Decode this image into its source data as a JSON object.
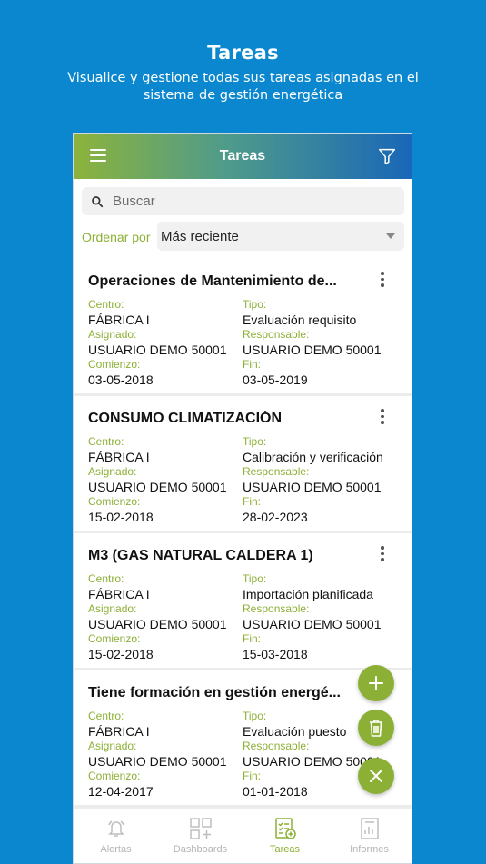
{
  "promo": {
    "title": "Tareas",
    "subtitle": "Visualice y gestione todas sus tareas asignadas en el sistema de gestión energética"
  },
  "appbar": {
    "title": "Tareas",
    "menu_icon": "hamburger-menu-icon",
    "filter_icon": "filter-funnel-icon"
  },
  "search": {
    "placeholder": "Buscar",
    "value": ""
  },
  "sort": {
    "label": "Ordenar por",
    "value": "Más reciente"
  },
  "field_labels": {
    "centro": "Centro:",
    "tipo": "Tipo:",
    "asignado": "Asignado:",
    "responsable": "Responsable:",
    "comienzo": "Comienzo:",
    "fin": "Fin:"
  },
  "tasks": [
    {
      "title": "Operaciones de Mantenimiento de...",
      "centro": "FÁBRICA I",
      "tipo": "Evaluación requisito",
      "asignado": "USUARIO DEMO 50001",
      "responsable": "USUARIO DEMO 50001",
      "comienzo": "03-05-2018",
      "fin": "03-05-2019"
    },
    {
      "title": "CONSUMO CLIMATIZACIÓN",
      "centro": "FÁBRICA I",
      "tipo": "Calibración y verificación",
      "asignado": "USUARIO DEMO 50001",
      "responsable": "USUARIO DEMO 50001",
      "comienzo": "15-02-2018",
      "fin": "28-02-2023"
    },
    {
      "title": "M3 (GAS NATURAL CALDERA 1)",
      "centro": "FÁBRICA I",
      "tipo": "Importación planificada",
      "asignado": "USUARIO DEMO 50001",
      "responsable": "USUARIO DEMO 50001",
      "comienzo": "15-02-2018",
      "fin": "15-03-2018"
    },
    {
      "title": "Tiene formación en gestión energé...",
      "centro": "FÁBRICA I",
      "tipo": "Evaluación puesto",
      "asignado": "USUARIO DEMO 50001",
      "responsable": "USUARIO DEMO 50001",
      "comienzo": "12-04-2017",
      "fin": "01-01-2018"
    }
  ],
  "fabs": {
    "add_icon": "plus-icon",
    "delete_icon": "trash-icon",
    "close_icon": "close-icon",
    "color": "#8cb036"
  },
  "bottom_nav": [
    {
      "label": "Alertas",
      "icon": "bell-icon",
      "active": false
    },
    {
      "label": "Dashboards",
      "icon": "dashboard-grid-icon",
      "active": false
    },
    {
      "label": "Tareas",
      "icon": "checklist-icon",
      "active": true
    },
    {
      "label": "Informes",
      "icon": "report-icon",
      "active": false
    }
  ],
  "colors": {
    "background": "#0a87cf",
    "accent_green": "#8cb036",
    "appbar_gradient_start": "#8db33c",
    "appbar_gradient_end": "#1967b8"
  }
}
